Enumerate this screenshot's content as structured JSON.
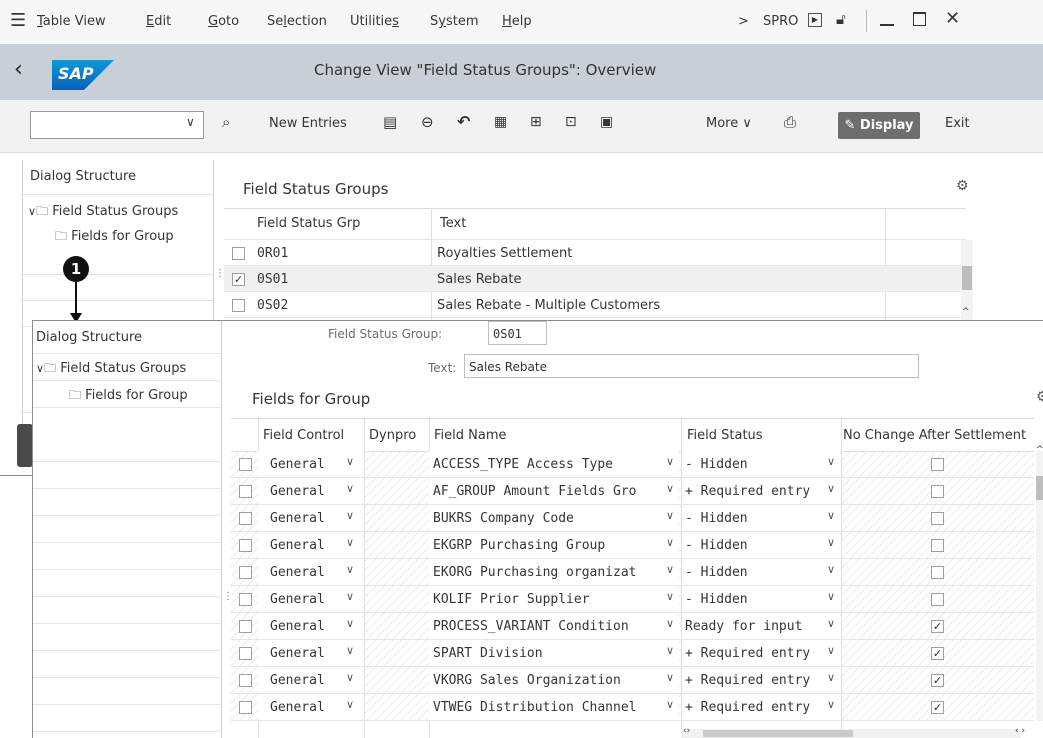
{
  "menu": {
    "items": [
      {
        "pre": "",
        "u": "T",
        "post": "able View"
      },
      {
        "pre": "",
        "u": "E",
        "post": "dit"
      },
      {
        "pre": "",
        "u": "G",
        "post": "oto"
      },
      {
        "pre": "Se",
        "u": "l",
        "post": "ection"
      },
      {
        "pre": "Utilitie",
        "u": "s",
        "post": ""
      },
      {
        "pre": "S",
        "u": "y",
        "post": "stem"
      },
      {
        "pre": "",
        "u": "H",
        "post": "elp"
      }
    ],
    "transaction": "SPRO"
  },
  "title": "Change View \"Field Status Groups\": Overview",
  "logo_text": "SAP",
  "toolbar": {
    "new_entries": "New Entries",
    "more": "More",
    "display": "Display",
    "exit": "Exit"
  },
  "back": {
    "dialog_structure": "Dialog Structure",
    "tree": [
      "Field Status Groups",
      "Fields for Group"
    ],
    "section_title": "Field Status Groups",
    "col_grp": "Field Status Grp",
    "col_text": "Text",
    "rows": [
      {
        "grp": "0R01",
        "text": "Royalties Settlement",
        "checked": false
      },
      {
        "grp": "0S01",
        "text": "Sales Rebate",
        "checked": true
      },
      {
        "grp": "0S02",
        "text": "Sales Rebate - Multiple Customers",
        "checked": false
      }
    ]
  },
  "callout": "1",
  "front": {
    "dialog_structure": "Dialog Structure",
    "tree": [
      "Field Status Groups",
      "Fields for Group"
    ],
    "fsg_label": "Field Status Group:",
    "fsg_value": "0S01",
    "text_label": "Text:",
    "text_value": "Sales Rebate",
    "section_title": "Fields for Group",
    "columns": [
      "Field Control",
      "Dynpro",
      "Field Name",
      "Field Status",
      "No Change After Settlement"
    ],
    "rows": [
      {
        "control": "General",
        "field": "ACCESS_TYPE Access Type",
        "status": "- Hidden",
        "no_change": false
      },
      {
        "control": "General",
        "field": "AF_GROUP Amount Fields Gro",
        "status": "+ Required entry",
        "no_change": false
      },
      {
        "control": "General",
        "field": "BUKRS Company Code",
        "status": "- Hidden",
        "no_change": false
      },
      {
        "control": "General",
        "field": "EKGRP Purchasing Group",
        "status": "- Hidden",
        "no_change": false
      },
      {
        "control": "General",
        "field": "EKORG Purchasing organizat",
        "status": "- Hidden",
        "no_change": false
      },
      {
        "control": "General",
        "field": "KOLIF Prior Supplier",
        "status": "- Hidden",
        "no_change": false
      },
      {
        "control": "General",
        "field": "PROCESS_VARIANT Condition",
        "status": "Ready for input",
        "no_change": true
      },
      {
        "control": "General",
        "field": "SPART Division",
        "status": "+ Required entry",
        "no_change": true
      },
      {
        "control": "General",
        "field": "VKORG Sales Organization",
        "status": "+ Required entry",
        "no_change": true
      },
      {
        "control": "General",
        "field": "VTWEG Distribution Channel",
        "status": "+ Required entry",
        "no_change": true
      }
    ]
  }
}
